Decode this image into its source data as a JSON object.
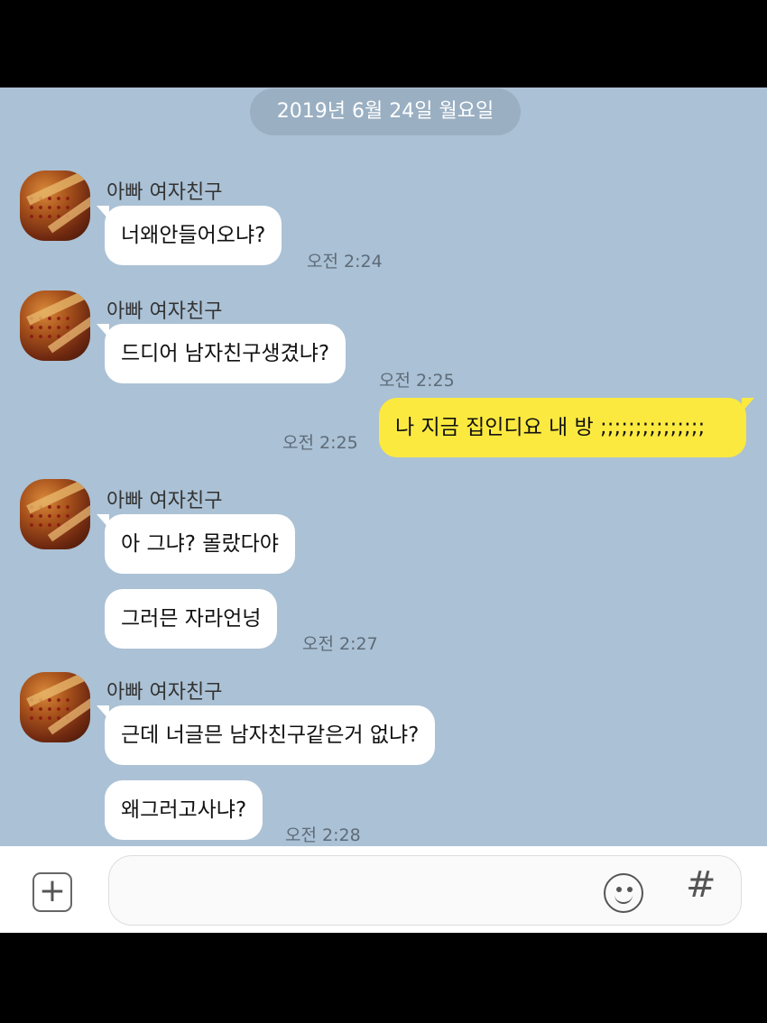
{
  "date_divider": "2019년 6월 24일 월요일",
  "messages": [
    {
      "sender": "아빠 여자친구",
      "lines": [
        "너왜안들어오냐?"
      ],
      "time": "오전 2:24"
    },
    {
      "sender": "아빠 여자친구",
      "lines": [
        "드디어 남자친구생겼냐?"
      ],
      "time": "오전 2:25"
    },
    {
      "mine": true,
      "lines": [
        "나 지금 집인디요 내 방 ;;;;;;;;;;;;;;;"
      ],
      "time": "오전 2:25"
    },
    {
      "sender": "아빠 여자친구",
      "lines": [
        "아 그냐? 몰랐다야",
        "그러믄 자라언넝"
      ],
      "time": "오전 2:27"
    },
    {
      "sender": "아빠 여자친구",
      "lines": [
        "근데 너글믄 남자친구같은거 없냐?",
        "왜그러고사냐?"
      ],
      "time": "오전 2:28"
    }
  ],
  "input_bar": {
    "plus_label": "+",
    "hash_label": "#",
    "icons": [
      "plus-icon",
      "emoji-icon",
      "hash-icon"
    ]
  },
  "colors": {
    "chat_background": "#abc1d5",
    "my_bubble": "#fce940",
    "their_bubble": "#ffffff"
  }
}
